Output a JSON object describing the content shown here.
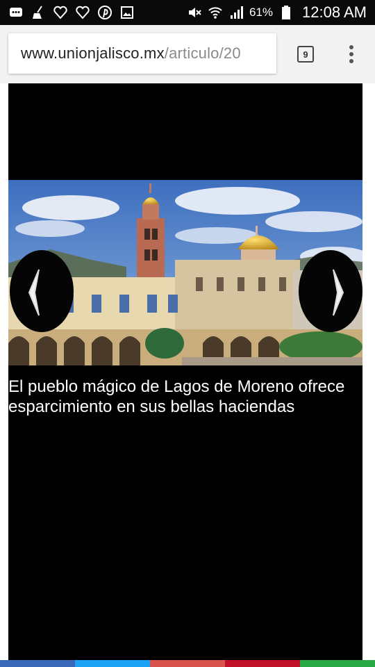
{
  "status_bar": {
    "icons_left": [
      "chat-icon",
      "broom-icon",
      "heart-icon",
      "heart-icon",
      "pinterest-icon",
      "image-icon"
    ],
    "icons_right": [
      "mute-icon",
      "wifi-icon",
      "signal-icon",
      "battery-icon"
    ],
    "battery_percent": "61%",
    "time": "12:08 AM"
  },
  "browser": {
    "url_host": "www.unionjalisco.mx",
    "url_path": "/articulo/20",
    "tab_count": "9",
    "menu_icon": "overflow-menu-icon"
  },
  "article": {
    "caption": "El pueblo mágico de Lagos de Moreno ofrece esparcimiento en sus bellas haciendas",
    "prev_icon": "chevron-left-icon",
    "next_icon": "chevron-right-icon"
  },
  "colors": {
    "status_bar": "#0a0a0a",
    "toolbar": "#f2f2f2",
    "article_bg": "#000000",
    "caption_text": "#ffffff",
    "sky": "#4a78c0",
    "dome": "#e0b53a",
    "bottom_strip": [
      "#3a68b8",
      "#1da1f2",
      "#d9534f",
      "#c0102a",
      "#29a845"
    ]
  }
}
